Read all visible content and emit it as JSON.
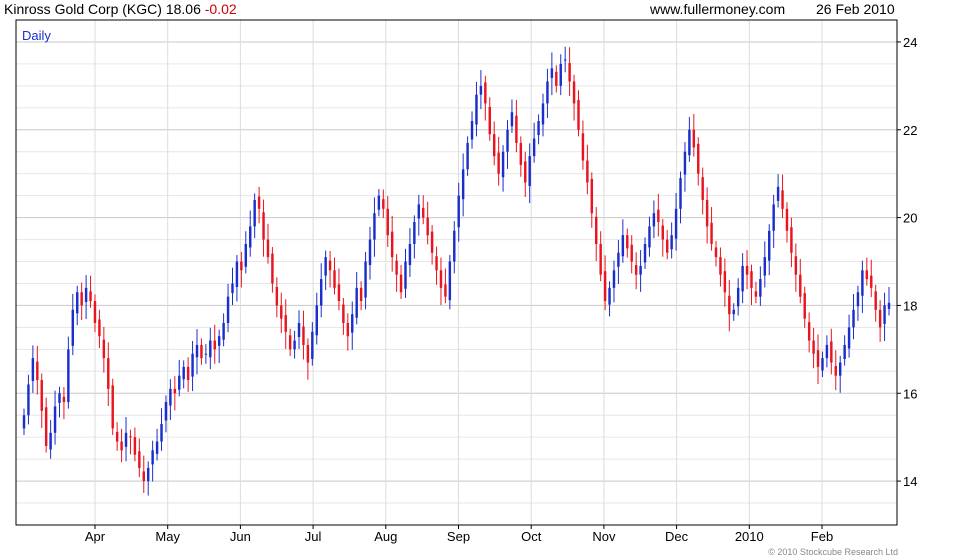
{
  "header": {
    "name": "Kinross Gold Corp (KGC)",
    "last": "18.06",
    "change": "-0.02",
    "site": "www.fullermoney.com",
    "date": "26 Feb 2010"
  },
  "chart_data": {
    "type": "candlestick",
    "label": "Daily",
    "credit": "© 2010 Stockcube Research Ltd",
    "ylim": [
      13,
      24.5
    ],
    "yticks": [
      14,
      16,
      18,
      20,
      22,
      24
    ],
    "xticks": [
      "Apr",
      "May",
      "Jun",
      "Jul",
      "Aug",
      "Sep",
      "Oct",
      "Nov",
      "Dec",
      "2010",
      "Feb"
    ],
    "grid": true,
    "up_color": "#1a2ecc",
    "down_color": "#e8141e",
    "closes": [
      15.5,
      16.2,
      16.8,
      16.3,
      15.6,
      14.8,
      15.1,
      15.7,
      16.0,
      15.8,
      17.0,
      17.9,
      18.3,
      18.0,
      18.4,
      18.1,
      17.6,
      17.3,
      16.8,
      16.1,
      15.2,
      14.9,
      14.7,
      15.1,
      15.0,
      14.6,
      14.3,
      14.0,
      14.3,
      14.7,
      14.9,
      15.3,
      15.8,
      16.1,
      16.0,
      16.4,
      16.6,
      16.3,
      16.9,
      17.1,
      16.8,
      16.9,
      17.2,
      17.0,
      17.3,
      17.6,
      18.2,
      18.5,
      19.0,
      18.8,
      19.4,
      19.8,
      20.4,
      20.2,
      19.5,
      19.1,
      18.5,
      18.0,
      17.7,
      17.4,
      17.0,
      17.2,
      17.6,
      17.1,
      16.7,
      17.4,
      18.0,
      18.6,
      19.1,
      18.8,
      18.4,
      18.1,
      17.6,
      17.3,
      17.8,
      18.4,
      18.1,
      19.0,
      19.5,
      20.1,
      20.5,
      20.2,
      19.6,
      19.1,
      18.7,
      18.3,
      19.0,
      19.4,
      19.9,
      20.3,
      20.0,
      19.6,
      19.2,
      18.8,
      18.4,
      18.2,
      19.0,
      19.7,
      20.5,
      21.1,
      21.7,
      22.2,
      22.8,
      23.0,
      22.6,
      21.9,
      21.4,
      21.0,
      21.5,
      22.0,
      22.4,
      21.7,
      21.2,
      20.8,
      21.4,
      21.8,
      22.2,
      22.6,
      23.1,
      23.4,
      23.0,
      23.5,
      23.6,
      23.1,
      22.6,
      22.0,
      21.3,
      20.8,
      20.1,
      19.4,
      18.7,
      18.1,
      18.4,
      18.8,
      19.2,
      19.6,
      19.3,
      19.0,
      18.7,
      18.9,
      19.4,
      19.8,
      20.1,
      19.9,
      19.5,
      19.2,
      19.6,
      20.2,
      20.9,
      21.5,
      22.0,
      21.6,
      21.0,
      20.4,
      19.8,
      19.4,
      19.1,
      18.7,
      18.3,
      17.8,
      17.9,
      18.4,
      18.9,
      18.7,
      18.4,
      18.2,
      18.6,
      19.1,
      19.7,
      20.3,
      20.7,
      20.2,
      19.7,
      19.2,
      18.7,
      18.2,
      17.7,
      17.2,
      16.9,
      16.6,
      16.8,
      17.1,
      16.7,
      16.4,
      16.7,
      17.1,
      17.5,
      17.9,
      18.3,
      18.8,
      18.6,
      18.4,
      17.9,
      17.5,
      18.0,
      18.06
    ]
  }
}
